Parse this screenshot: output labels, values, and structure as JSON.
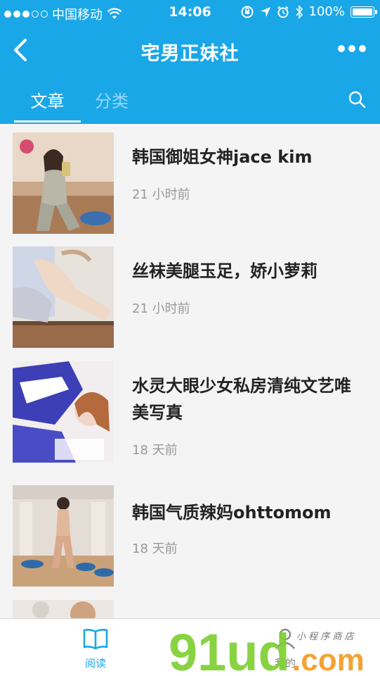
{
  "status_bar": {
    "carrier": "中国移动",
    "time": "14:06",
    "battery": "100%"
  },
  "nav": {
    "title": "宅男正妹社",
    "back_icon": "chevron-left-icon",
    "more_icon": "more-dots-icon"
  },
  "tabs": [
    {
      "label": "文章",
      "active": true
    },
    {
      "label": "分类",
      "active": false
    }
  ],
  "search_icon": "search-icon",
  "articles": [
    {
      "title": "韩国御姐女神jace kim",
      "time": "21 小时前"
    },
    {
      "title": "丝袜美腿玉足，娇小萝莉",
      "time": "21 小时前"
    },
    {
      "title": "水灵大眼少女私房清纯文艺唯美写真",
      "time": "18 天前"
    },
    {
      "title": "韩国气质辣妈ohttomom",
      "time": "18 天前"
    }
  ],
  "bottom_tabs": [
    {
      "label": "阅读",
      "icon": "book-icon",
      "active": true
    },
    {
      "label": "我的",
      "icon": "user-icon",
      "active": false
    }
  ],
  "watermark": {
    "text": "91ud",
    "suffix": ".com",
    "tagline": "小程序商店"
  },
  "colors": {
    "accent": "#1aa7e8",
    "watermark_green": "#7ccf2e",
    "watermark_orange": "#f29a1f"
  }
}
